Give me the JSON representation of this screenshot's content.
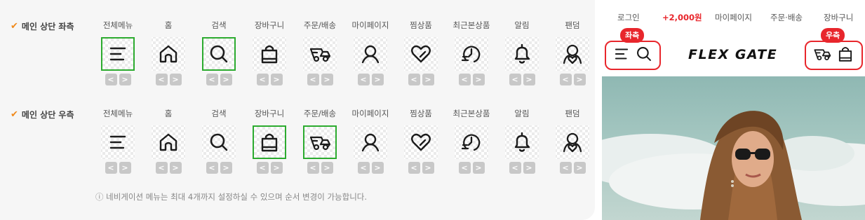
{
  "columns": [
    "전체메뉴",
    "홈",
    "검색",
    "장바구니",
    "주문/배송",
    "마이페이지",
    "찜상품",
    "최근본상품",
    "알림",
    "팬덤"
  ],
  "icon_names": [
    "menu-icon",
    "home-icon",
    "search-icon",
    "cart-icon",
    "delivery-icon",
    "mypage-icon",
    "wishlist-icon",
    "recent-icon",
    "bell-icon",
    "fandom-icon"
  ],
  "rows": [
    {
      "label": "메인 상단 좌측",
      "selected": [
        0,
        2
      ]
    },
    {
      "label": "메인 상단 우측",
      "selected": [
        3,
        4
      ]
    }
  ],
  "arrow_prev": "<",
  "arrow_next": ">",
  "check_glyph": "✔",
  "notice": "ⓘ 네비게이션 메뉴는 최대 4개까지 설정하실 수 있으며 순서 변경이 가능합니다.",
  "preview": {
    "topbar": [
      "로그인",
      "+2,000원",
      "마이페이지",
      "주문·배송",
      "장바구니"
    ],
    "left_badge": "좌측",
    "right_badge": "우측",
    "logo": "FLEX GATE"
  },
  "colors": {
    "selected_border": "#2cab2f",
    "accent_red": "#e8262c",
    "check": "#f08a1c"
  }
}
